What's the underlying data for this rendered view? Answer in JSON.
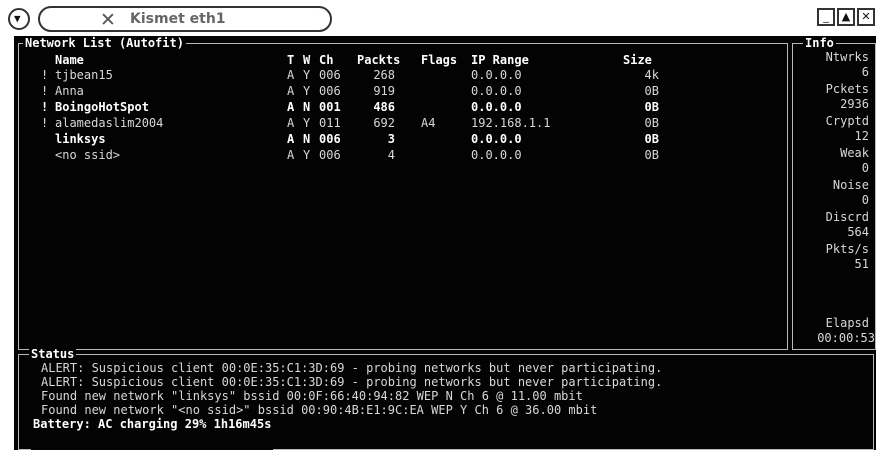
{
  "window": {
    "title": "Kismet eth1",
    "title_icon": "x-close-icon",
    "menu_icon": "chevron-down-icon",
    "buttons": {
      "minimize": "_",
      "maximize": "▲",
      "close": "✕"
    }
  },
  "network_list": {
    "title": "Network List",
    "mode": "(Autofit)",
    "columns": {
      "name": "Name",
      "t": "T",
      "w": "W",
      "ch": "Ch",
      "packets": "Packts",
      "flags": "Flags",
      "ip": "IP Range",
      "size": "Size"
    },
    "rows": [
      {
        "mark": "!",
        "name": "tjbean15",
        "t": "A",
        "w": "Y",
        "ch": "006",
        "packets": "268",
        "flags": "",
        "ip": "0.0.0.0",
        "size": "4k",
        "bold": false
      },
      {
        "mark": "!",
        "name": "Anna",
        "t": "A",
        "w": "Y",
        "ch": "006",
        "packets": "919",
        "flags": "",
        "ip": "0.0.0.0",
        "size": "0B",
        "bold": false
      },
      {
        "mark": "!",
        "name": "BoingoHotSpot",
        "t": "A",
        "w": "N",
        "ch": "001",
        "packets": "486",
        "flags": "",
        "ip": "0.0.0.0",
        "size": "0B",
        "bold": true
      },
      {
        "mark": "!",
        "name": "alamedaslim2004",
        "t": "A",
        "w": "Y",
        "ch": "011",
        "packets": "692",
        "flags": "A4",
        "ip": "192.168.1.1",
        "size": "0B",
        "bold": false
      },
      {
        "mark": "",
        "name": "linksys",
        "t": "A",
        "w": "N",
        "ch": "006",
        "packets": "3",
        "flags": "",
        "ip": "0.0.0.0",
        "size": "0B",
        "bold": true
      },
      {
        "mark": "",
        "name": "<no ssid>",
        "t": "A",
        "w": "Y",
        "ch": "006",
        "packets": "4",
        "flags": "",
        "ip": "0.0.0.0",
        "size": "0B",
        "bold": false
      }
    ]
  },
  "info": {
    "title": "Info",
    "stats": [
      {
        "label": "Ntwrks",
        "value": "6"
      },
      {
        "label": "Pckets",
        "value": "2936"
      },
      {
        "label": "Cryptd",
        "value": "12"
      },
      {
        "label": "Weak",
        "value": "0"
      },
      {
        "label": "Noise",
        "value": "0"
      },
      {
        "label": "Discrd",
        "value": "564"
      },
      {
        "label": "Pkts/s",
        "value": "51"
      }
    ],
    "elapsed_label": "Elapsd",
    "elapsed_value": "00:00:53"
  },
  "status": {
    "title": "Status",
    "lines": [
      "ALERT: Suspicious client 00:0E:35:C1:3D:69 - probing networks but never participating.",
      "ALERT: Suspicious client 00:0E:35:C1:3D:69 - probing networks but never participating.",
      "Found new network \"linksys\" bssid 00:0F:66:40:94:82 WEP N Ch 6 @ 11.00 mbit",
      "Found new network \"<no ssid>\" bssid 00:90:4B:E1:9C:EA WEP Y Ch 6 @ 36.00 mbit"
    ],
    "battery": "Battery: AC charging 29% 1h16m45s"
  }
}
